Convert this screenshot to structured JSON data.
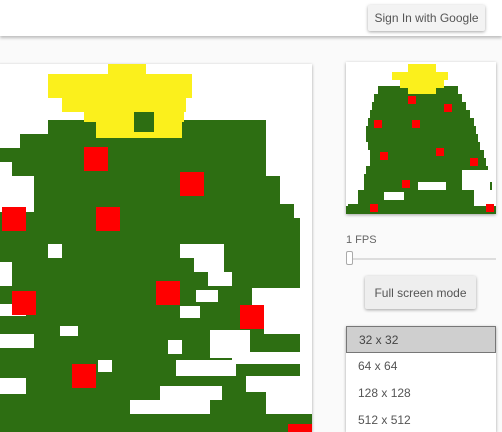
{
  "header": {
    "sign_in_label": "Sign In with Google"
  },
  "colors": {
    "tree": "#2d6e12",
    "star": "#fbf01c",
    "ornament": "#ff0000",
    "background": "#ffffff"
  },
  "controls": {
    "fps_label": "1 FPS",
    "fps_slider_fraction": 0.0,
    "fullscreen_label": "Full screen mode"
  },
  "sizes": {
    "selected_index": 0,
    "options": [
      "32 x 32",
      "64 x 64",
      "128 x 128",
      "512 x 512"
    ]
  }
}
